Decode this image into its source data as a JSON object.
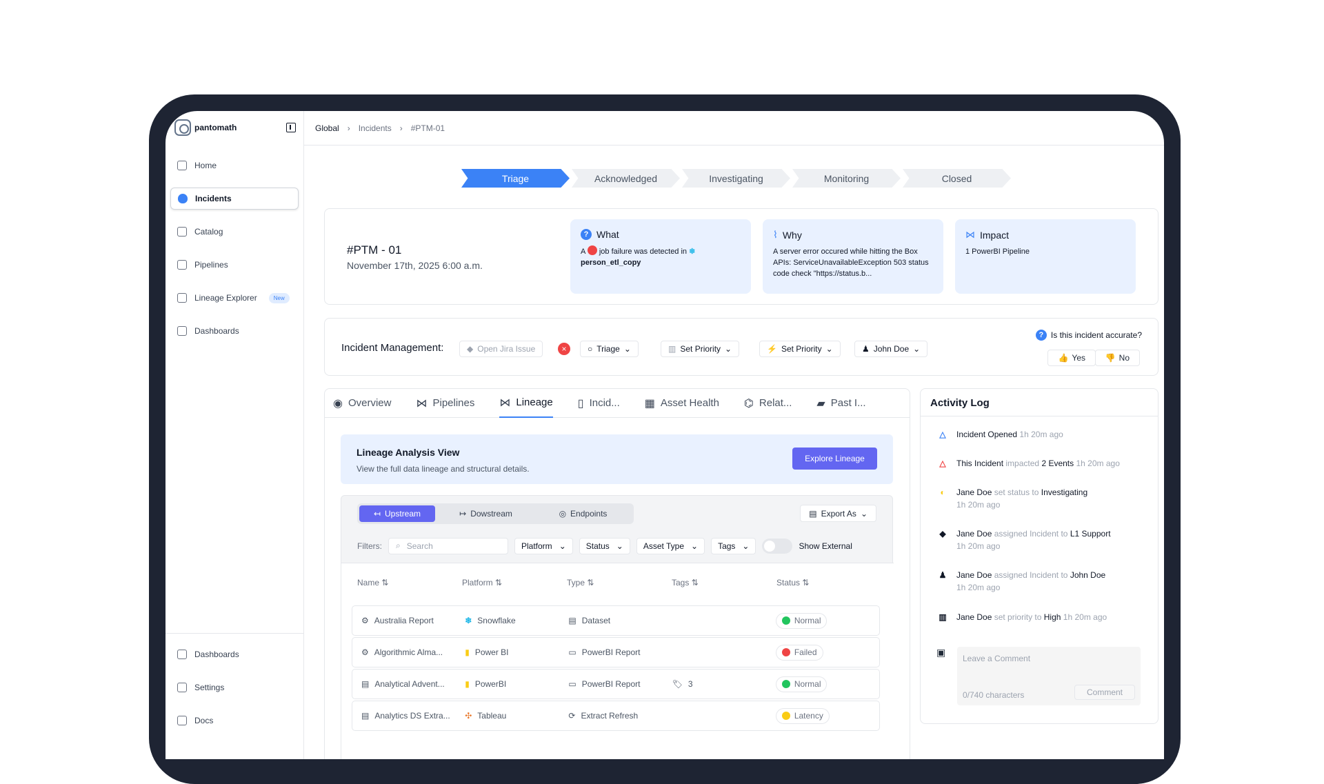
{
  "app": {
    "name": "pantomath"
  },
  "sidebar": {
    "items": [
      {
        "label": "Home",
        "icon": "home-icon"
      },
      {
        "label": "Incidents",
        "icon": "shield-icon",
        "active": true
      },
      {
        "label": "Catalog",
        "icon": "database-icon"
      },
      {
        "label": "Pipelines",
        "icon": "share-icon"
      },
      {
        "label": "Lineage Explorer",
        "icon": "lineage-icon",
        "badge": "New"
      },
      {
        "label": "Dashboards",
        "icon": "dashboard-icon"
      }
    ],
    "bottom_items": [
      {
        "label": "Dashboards",
        "icon": "bell-icon"
      },
      {
        "label": "Settings",
        "icon": "gear-icon"
      },
      {
        "label": "Docs",
        "icon": "document-icon"
      }
    ]
  },
  "breadcrumb": [
    "Global",
    "Incidents",
    "#PTM-01"
  ],
  "stages": [
    "Triage",
    "Acknowledged",
    "Investigating",
    "Monitoring",
    "Closed"
  ],
  "incident": {
    "id": "#PTM - 01",
    "date": "November 17th, 2025 6:00 a.m.",
    "what_title": "What",
    "what_text_prefix": "A",
    "what_text_middle": "job failure was detected in",
    "what_asset": "person_etl_copy",
    "why_title": "Why",
    "why_text": "A server error occured while hitting the Box APIs: ServiceUnavailableException 503 status code check \"https://status.b...",
    "impact_title": "Impact",
    "impact_text": "1 PowerBI Pipeline"
  },
  "management": {
    "label": "Incident Management:",
    "jira": "Open Jira Issue",
    "status": "Triage",
    "priority_1": "Set Priority",
    "priority_2": "Set Priority",
    "assignee": "John Doe",
    "accuracy_question": "Is this incident accurate?",
    "yes": "Yes",
    "no": "No"
  },
  "tabs": [
    "Overview",
    "Pipelines",
    "Lineage",
    "Incid...",
    "Asset Health",
    "Relat...",
    "Past I..."
  ],
  "lineage": {
    "title": "Lineage Analysis View",
    "description": "View the full data lineage and structural details.",
    "button": "Explore Lineage",
    "segments": [
      "Upstream",
      "Dowstream",
      "Endpoints"
    ],
    "export": "Export As",
    "filters_label": "Filters:",
    "search_placeholder": "Search",
    "filters": [
      "Platform",
      "Status",
      "Asset Type",
      "Tags"
    ],
    "show_external": "Show External",
    "columns": [
      "Name",
      "Platform",
      "Type",
      "Tags",
      "Status"
    ],
    "rows": [
      {
        "name": "Australia Report",
        "platform": "Snowflake",
        "type": "Dataset",
        "tags": "",
        "status": "Normal",
        "status_color": "#22c55e"
      },
      {
        "name": "Algorithmic Alma...",
        "platform": "Power BI",
        "type": "PowerBI Report",
        "tags": "",
        "status": "Failed",
        "status_color": "#ef4444"
      },
      {
        "name": "Analytical Advent...",
        "platform": "PowerBI",
        "type": "PowerBI Report",
        "tags": "3",
        "status": "Normal",
        "status_color": "#22c55e"
      },
      {
        "name": "Analytics DS Extra...",
        "platform": "Tableau",
        "type": "Extract Refresh",
        "tags": "",
        "status": "Latency",
        "status_color": "#facc15"
      }
    ]
  },
  "activity": {
    "title": "Activity Log",
    "items": [
      {
        "actor": "Incident Opened",
        "action": "",
        "target": "",
        "time": "1h 20m ago"
      },
      {
        "actor": "This Incident",
        "action": "impacted",
        "target": "2 Events",
        "time": "1h 20m ago"
      },
      {
        "actor": "Jane Doe",
        "action": "set status to",
        "target": "Investigating",
        "time": "1h 20m ago"
      },
      {
        "actor": "Jane Doe",
        "action": "assigned Incident to",
        "target": "L1 Support",
        "time": "1h 20m ago"
      },
      {
        "actor": "Jane Doe",
        "action": "assigned Incident to",
        "target": "John Doe",
        "time": "1h 20m ago"
      },
      {
        "actor": "Jane Doe",
        "action": "set priority to",
        "target": "High",
        "time": "1h 20m ago"
      }
    ],
    "comment_placeholder": "Leave a Comment",
    "character_count": "0/740 characters",
    "comment_button": "Comment"
  }
}
